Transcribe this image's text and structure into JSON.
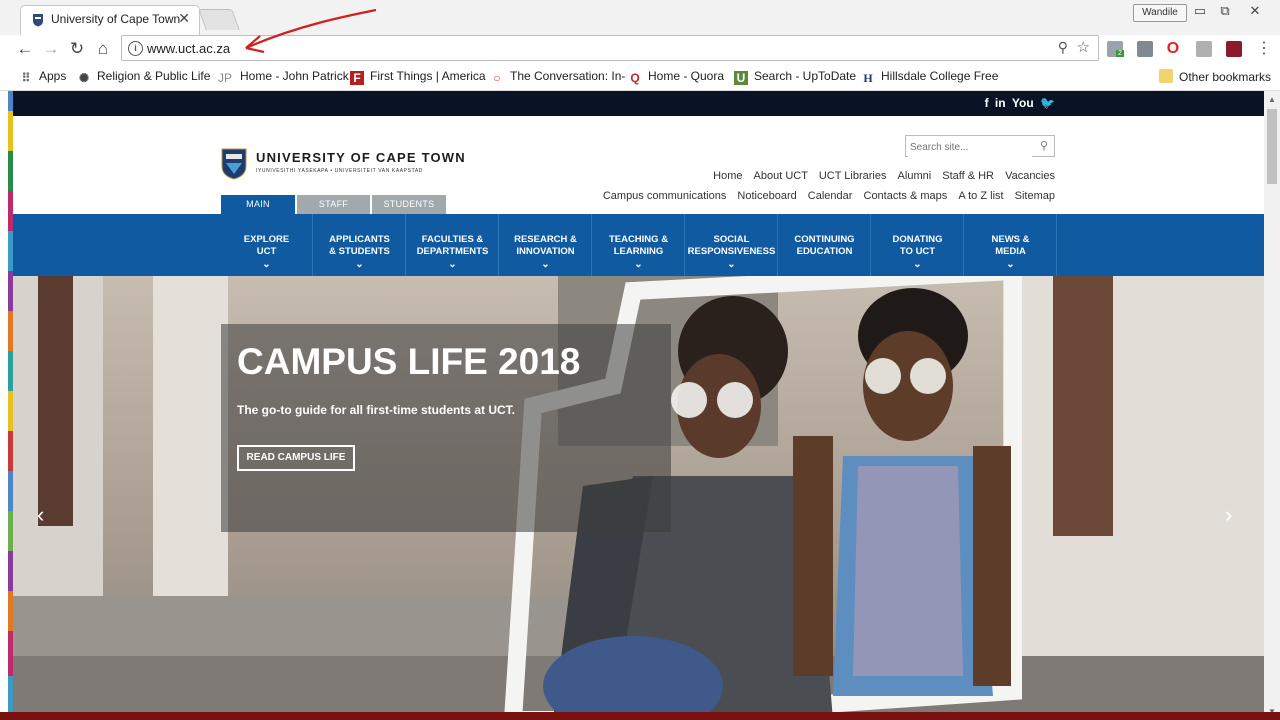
{
  "browser": {
    "tab_title": "University of Cape Town",
    "profile_name": "Wandile",
    "url": "www.uct.ac.za",
    "extension_badge": "2"
  },
  "bookmarks": [
    {
      "label": "Apps",
      "icon": "apps-grid-icon"
    },
    {
      "label": "Religion & Public Life",
      "icon": "sunburst-icon"
    },
    {
      "label": "Home - John Patrick",
      "icon": "jp-icon"
    },
    {
      "label": "First Things | America",
      "icon": "f-icon"
    },
    {
      "label": "The Conversation: In-",
      "icon": "conversation-icon"
    },
    {
      "label": "Home - Quora",
      "icon": "quora-icon"
    },
    {
      "label": "Search - UpToDate",
      "icon": "uptodate-icon"
    },
    {
      "label": "Hillsdale College Free",
      "icon": "hillsdale-icon"
    },
    {
      "label": "Other bookmarks",
      "icon": "folder-icon"
    }
  ],
  "site": {
    "social": [
      "f",
      "in",
      "You",
      "twitter"
    ],
    "logo_name": "UNIVERSITY OF CAPE TOWN",
    "logo_sub": "IYUNIVESITHI YASEKAPA • UNIVERSITEIT VAN KAAPSTAD",
    "audience_tabs": [
      "MAIN",
      "STAFF",
      "STUDENTS"
    ],
    "search_placeholder": "Search site...",
    "util_links_1": [
      "Home",
      "About UCT",
      "UCT Libraries",
      "Alumni",
      "Staff & HR",
      "Vacancies"
    ],
    "util_links_2": [
      "Campus communications",
      "Noticeboard",
      "Calendar",
      "Contacts & maps",
      "A to Z list",
      "Sitemap"
    ],
    "nav": [
      [
        "EXPLORE",
        "UCT"
      ],
      [
        "APPLICANTS",
        "& STUDENTS"
      ],
      [
        "FACULTIES &",
        "DEPARTMENTS"
      ],
      [
        "RESEARCH &",
        "INNOVATION"
      ],
      [
        "TEACHING &",
        "LEARNING"
      ],
      [
        "SOCIAL",
        "RESPONSIVENESS"
      ],
      [
        "CONTINUING",
        "EDUCATION"
      ],
      [
        "DONATING",
        "TO UCT"
      ],
      [
        "NEWS &",
        "MEDIA"
      ]
    ],
    "hero": {
      "title": "CAMPUS LIFE 2018",
      "subtitle": "The go-to guide for all first-time students at UCT.",
      "button": "READ CAMPUS LIFE"
    }
  },
  "colors": {
    "nav_blue": "#0f5aa0",
    "top_bar": "#0a1326",
    "tab_active": "#0f5aa0",
    "tab_inactive": "#9aa0a6"
  }
}
